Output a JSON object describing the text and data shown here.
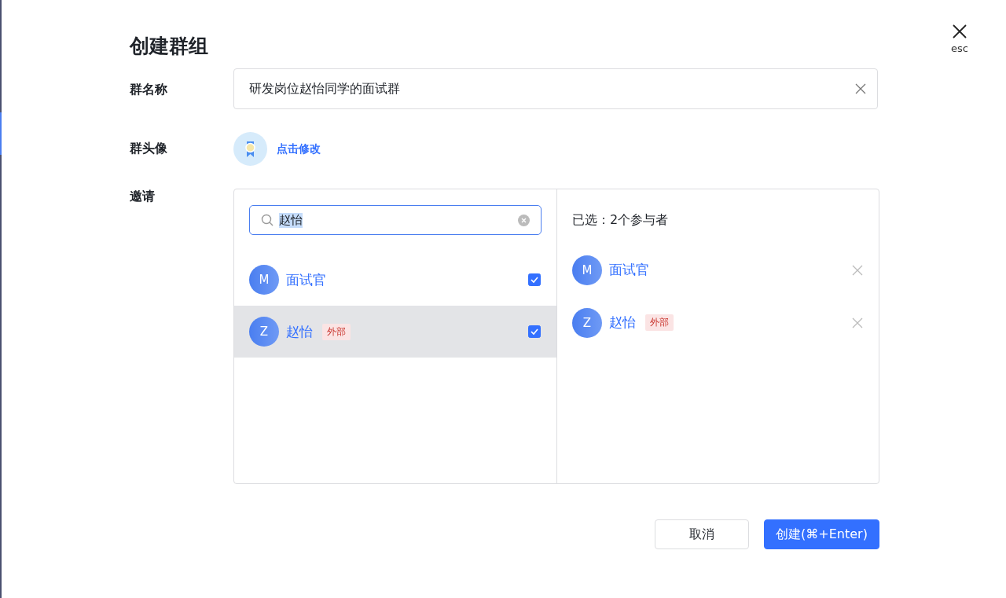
{
  "title": "创建群组",
  "close": {
    "label": "esc"
  },
  "name_field": {
    "label": "群名称",
    "value": "研发岗位赵怡同学的面试群"
  },
  "avatar": {
    "label": "群头像",
    "link": "点击修改"
  },
  "invite": {
    "label": "邀请",
    "search": {
      "value": "赵怡"
    },
    "results": [
      {
        "initial": "M",
        "name": "面试官",
        "selected": false,
        "checked": true
      },
      {
        "initial": "Z",
        "name": "赵怡",
        "tag": "外部",
        "selected": true,
        "checked": true
      }
    ],
    "summary": "已选：2个参与者",
    "chosen": [
      {
        "initial": "M",
        "name": "面试官"
      },
      {
        "initial": "Z",
        "name": "赵怡",
        "tag": "外部"
      }
    ]
  },
  "buttons": [
    {
      "label": "取消",
      "kind": "secondary"
    },
    {
      "label": "创建(⌘+Enter)",
      "kind": "primary"
    }
  ]
}
